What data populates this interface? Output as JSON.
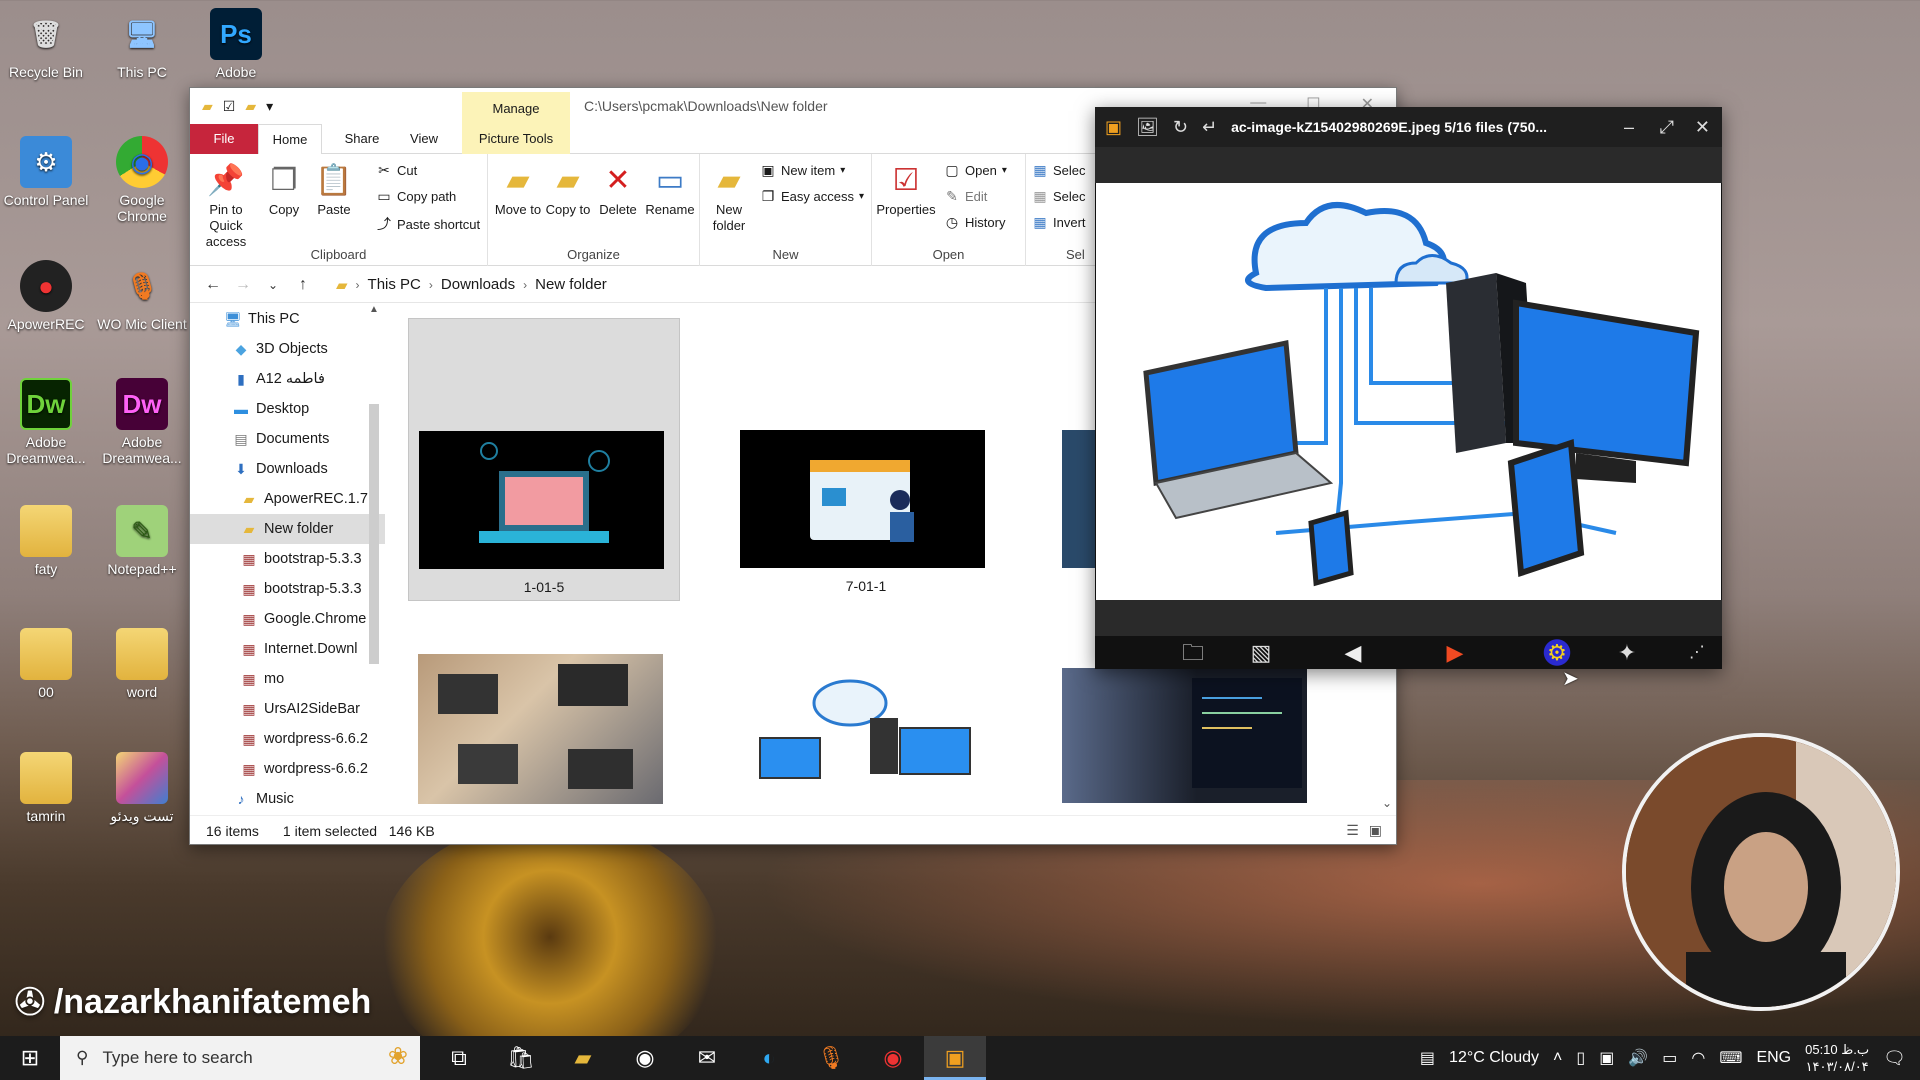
{
  "desktop": {
    "icons": [
      {
        "label": "Recycle Bin",
        "glyph": "🗑"
      },
      {
        "label": "This PC",
        "glyph": "🖥"
      },
      {
        "label": "Adobe",
        "glyph": "Ps"
      },
      {
        "label": "Control Panel",
        "glyph": "⚙"
      },
      {
        "label": "Google Chrome",
        "glyph": "◉"
      },
      {
        "label": "ApowerREC",
        "glyph": "●"
      },
      {
        "label": "WO Mic Client",
        "glyph": "🎙"
      },
      {
        "label": "Adobe Dreamwea...",
        "glyph": "Dw"
      },
      {
        "label": "Adobe Dreamwea...",
        "glyph": "Dw"
      },
      {
        "label": "faty",
        "glyph": "📁"
      },
      {
        "label": "Notepad++",
        "glyph": "✎"
      },
      {
        "label": "00",
        "glyph": "📄"
      },
      {
        "label": "word",
        "glyph": "📄"
      },
      {
        "label": "tamrin",
        "glyph": "📁"
      },
      {
        "label": "تست ویدئو",
        "glyph": "📁"
      }
    ]
  },
  "explorer": {
    "title_path": "C:\\Users\\pcmak\\Downloads\\New folder",
    "manage_label": "Manage",
    "tabs": {
      "file": "File",
      "home": "Home",
      "share": "Share",
      "view": "View",
      "picture_tools": "Picture Tools"
    },
    "ribbon": {
      "clipboard": {
        "label": "Clipboard",
        "pin": "Pin to Quick access",
        "copy": "Copy",
        "paste": "Paste",
        "cut": "Cut",
        "copy_path": "Copy path",
        "paste_shortcut": "Paste shortcut"
      },
      "organize": {
        "label": "Organize",
        "move_to": "Move to",
        "copy_to": "Copy to",
        "delete": "Delete",
        "rename": "Rename"
      },
      "new": {
        "label": "New",
        "new_folder": "New folder",
        "new_item": "New item",
        "easy_access": "Easy access"
      },
      "open": {
        "label": "Open",
        "properties": "Properties",
        "open": "Open",
        "edit": "Edit",
        "history": "History"
      },
      "select": {
        "label": "Sel",
        "select_all": "Selec",
        "select_none": "Selec",
        "invert": "Invert"
      }
    },
    "breadcrumb": [
      "This PC",
      "Downloads",
      "New folder"
    ],
    "nav_items": [
      {
        "label": "This PC",
        "glyph": "🖥",
        "indent": 0
      },
      {
        "label": "3D Objects",
        "glyph": "◆",
        "indent": 1
      },
      {
        "label": "A12 فاطمه",
        "glyph": "▮",
        "indent": 1
      },
      {
        "label": "Desktop",
        "glyph": "▬",
        "indent": 1
      },
      {
        "label": "Documents",
        "glyph": "▤",
        "indent": 1
      },
      {
        "label": "Downloads",
        "glyph": "⬇",
        "indent": 1
      },
      {
        "label": "ApowerREC.1.7",
        "glyph": "▰",
        "indent": 2
      },
      {
        "label": "New folder",
        "glyph": "▰",
        "indent": 2
      },
      {
        "label": "bootstrap-5.3.3",
        "glyph": "▦",
        "indent": 2
      },
      {
        "label": "bootstrap-5.3.3",
        "glyph": "▦",
        "indent": 2
      },
      {
        "label": "Google.Chrome",
        "glyph": "▦",
        "indent": 2
      },
      {
        "label": "Internet.Downl",
        "glyph": "▦",
        "indent": 2
      },
      {
        "label": "mo",
        "glyph": "▦",
        "indent": 2
      },
      {
        "label": "UrsAI2SideBar",
        "glyph": "▦",
        "indent": 2
      },
      {
        "label": "wordpress-6.6.2",
        "glyph": "▦",
        "indent": 2
      },
      {
        "label": "wordpress-6.6.2",
        "glyph": "▦",
        "indent": 2
      },
      {
        "label": "Music",
        "glyph": "♪",
        "indent": 1
      }
    ],
    "files": [
      {
        "name": "1-01-5",
        "selected": true
      },
      {
        "name": "7-01-1",
        "selected": false
      },
      {
        "name": "",
        "selected": false
      },
      {
        "name": "",
        "selected": false
      },
      {
        "name": "",
        "selected": false
      },
      {
        "name": "",
        "selected": false
      }
    ],
    "status": {
      "count": "16 items",
      "selection": "1 item selected",
      "size": "146 KB"
    }
  },
  "viewer": {
    "title": "ac-image-kZ15402980269E.jpeg 5/16 files (750..."
  },
  "watermark": "/nazarkhanifatemeh",
  "taskbar": {
    "search_placeholder": "Type here to search",
    "weather": "12°C  Cloudy",
    "lang": "ENG",
    "time": "05:10 ب.ظ",
    "date": "۱۴۰۳/۰۸/۰۴"
  },
  "colors": {
    "file_tab": "#c6253c",
    "manage_tab": "#fcf3b8",
    "accent": "#1e6ec8"
  }
}
